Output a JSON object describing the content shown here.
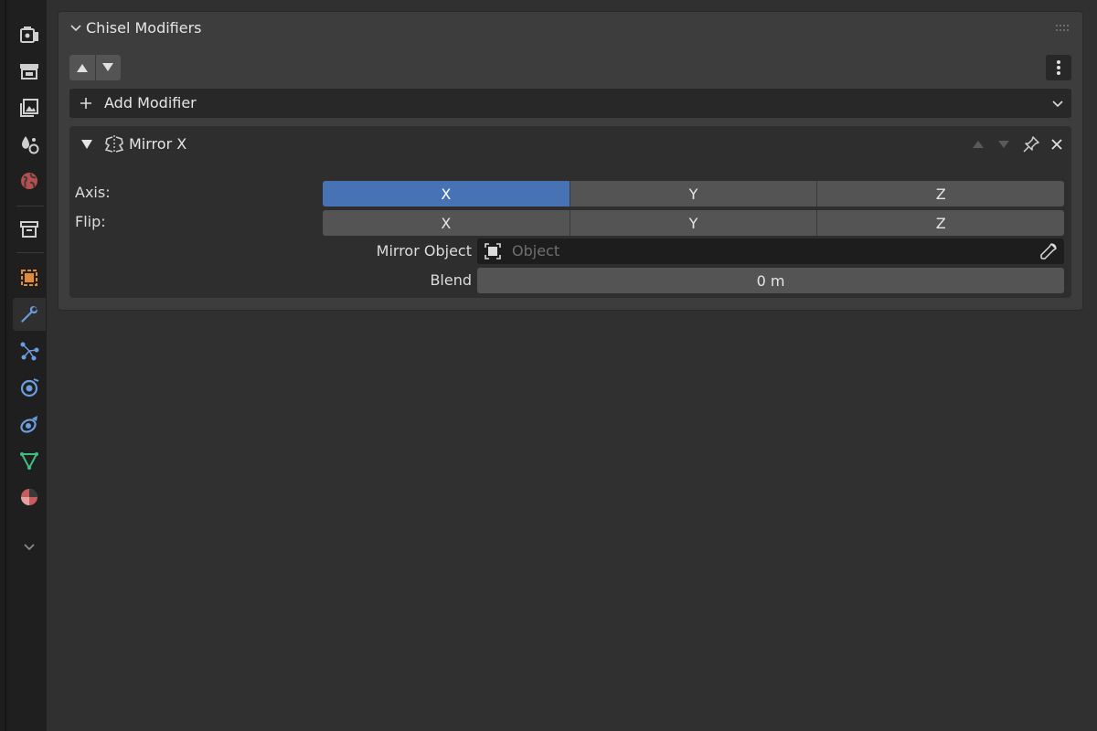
{
  "panel": {
    "title": "Chisel Modifiers",
    "add_modifier_label": "Add Modifier"
  },
  "modifier": {
    "name": "Mirror X",
    "icon": "mirror-modifier-icon",
    "axis_label": "Axis:",
    "flip_label": "Flip:",
    "axis_options": [
      "X",
      "Y",
      "Z"
    ],
    "axis_selected": "X",
    "flip_options": [
      "X",
      "Y",
      "Z"
    ],
    "mirror_object_label": "Mirror Object",
    "mirror_object_placeholder": "Object",
    "blend_label": "Blend",
    "blend_value": "0 m"
  },
  "tabs": [
    {
      "name": "tool-icon",
      "color": "#d0d0d0"
    },
    {
      "name": "render-icon",
      "color": "#d0d0d0"
    },
    {
      "name": "output-icon",
      "color": "#d0d0d0"
    },
    {
      "name": "view-layer-icon",
      "color": "#d0d0d0"
    },
    {
      "name": "scene-icon",
      "color": "#d0d0d0"
    },
    {
      "name": "world-icon",
      "color": "#c25b5b"
    },
    {
      "name": "collection-icon",
      "color": "#d0d0d0"
    },
    {
      "name": "object-icon",
      "color": "#e08a3c"
    },
    {
      "name": "modifier-wrench-icon",
      "color": "#6a9ee0"
    },
    {
      "name": "particles-icon",
      "color": "#6a9ee0"
    },
    {
      "name": "physics-icon",
      "color": "#6a9ee0"
    },
    {
      "name": "constraints-icon",
      "color": "#6a9ee0"
    },
    {
      "name": "data-icon",
      "color": "#3fbf7f"
    },
    {
      "name": "material-icon",
      "color": "#d06a6a"
    }
  ],
  "colors": {
    "accent_selected": "#4772b3",
    "panel_bg": "#3d3d3d",
    "button_bg": "#545454",
    "field_bg": "#1d1d1d"
  }
}
